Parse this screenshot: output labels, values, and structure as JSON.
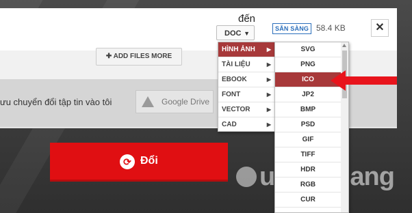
{
  "header": {
    "to_label": "đến",
    "format_select": "DOC",
    "status_badge": "SẴN SÀNG",
    "file_size": "58.4 KB"
  },
  "toolbar": {
    "add_files_label": "ADD FILES MORE",
    "save_text": "ưu chuyển đổi tập tin vào tôi",
    "google_drive_label": "Google Drive",
    "convert_label": "Đổi"
  },
  "menu": {
    "categories": [
      {
        "label": "HÌNH ẢNH",
        "active": true
      },
      {
        "label": "TÀI LIỆU",
        "active": false
      },
      {
        "label": "EBOOK",
        "active": false
      },
      {
        "label": "FONT",
        "active": false
      },
      {
        "label": "VECTOR",
        "active": false
      },
      {
        "label": "CAD",
        "active": false
      }
    ],
    "formats": [
      {
        "label": "SVG",
        "active": false
      },
      {
        "label": "PNG",
        "active": false
      },
      {
        "label": "ICO",
        "active": true
      },
      {
        "label": "JP2",
        "active": false
      },
      {
        "label": "BMP",
        "active": false
      },
      {
        "label": "PSD",
        "active": false
      },
      {
        "label": "GIF",
        "active": false
      },
      {
        "label": "TIFF",
        "active": false
      },
      {
        "label": "HDR",
        "active": false
      },
      {
        "label": "RGB",
        "active": false
      },
      {
        "label": "CUR",
        "active": false
      }
    ]
  },
  "watermark": {
    "text": "uantrimang"
  },
  "colors": {
    "accent_red": "#e00f12",
    "menu_active": "#a7393a",
    "badge_blue": "#2a6ebb"
  }
}
